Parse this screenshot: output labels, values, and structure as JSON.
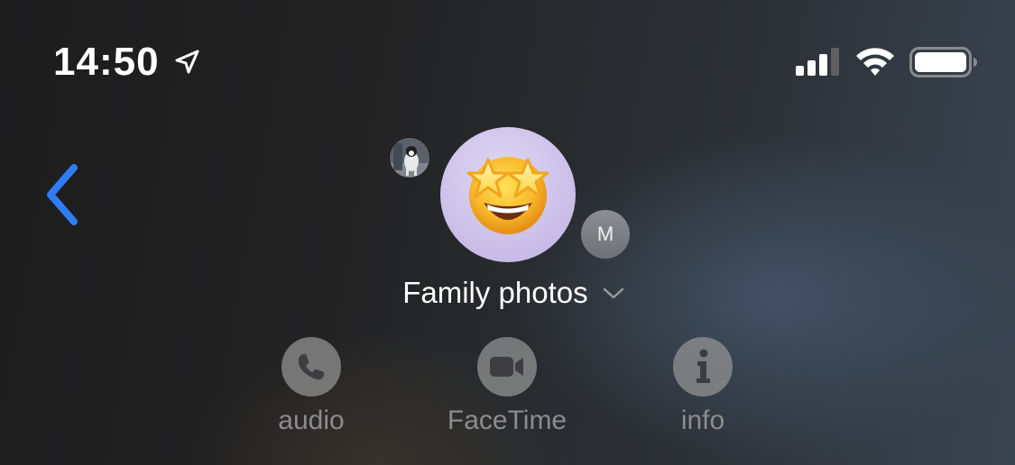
{
  "status_bar": {
    "time": "14:50",
    "location_icon": "location-arrow-icon",
    "signal_icon": "cellular-signal-icon",
    "wifi_icon": "wifi-icon",
    "battery_icon": "battery-icon"
  },
  "header": {
    "back_icon": "chevron-left-icon",
    "back_color": "#2f7cf6",
    "avatar_emoji": "🤩",
    "avatar_letter": "M",
    "group_name": "Family photos",
    "group_chevron_icon": "chevron-down-icon"
  },
  "actions": [
    {
      "label": "audio",
      "icon": "phone-icon"
    },
    {
      "label": "FaceTime",
      "icon": "video-camera-icon"
    },
    {
      "label": "info",
      "icon": "info-icon"
    }
  ]
}
